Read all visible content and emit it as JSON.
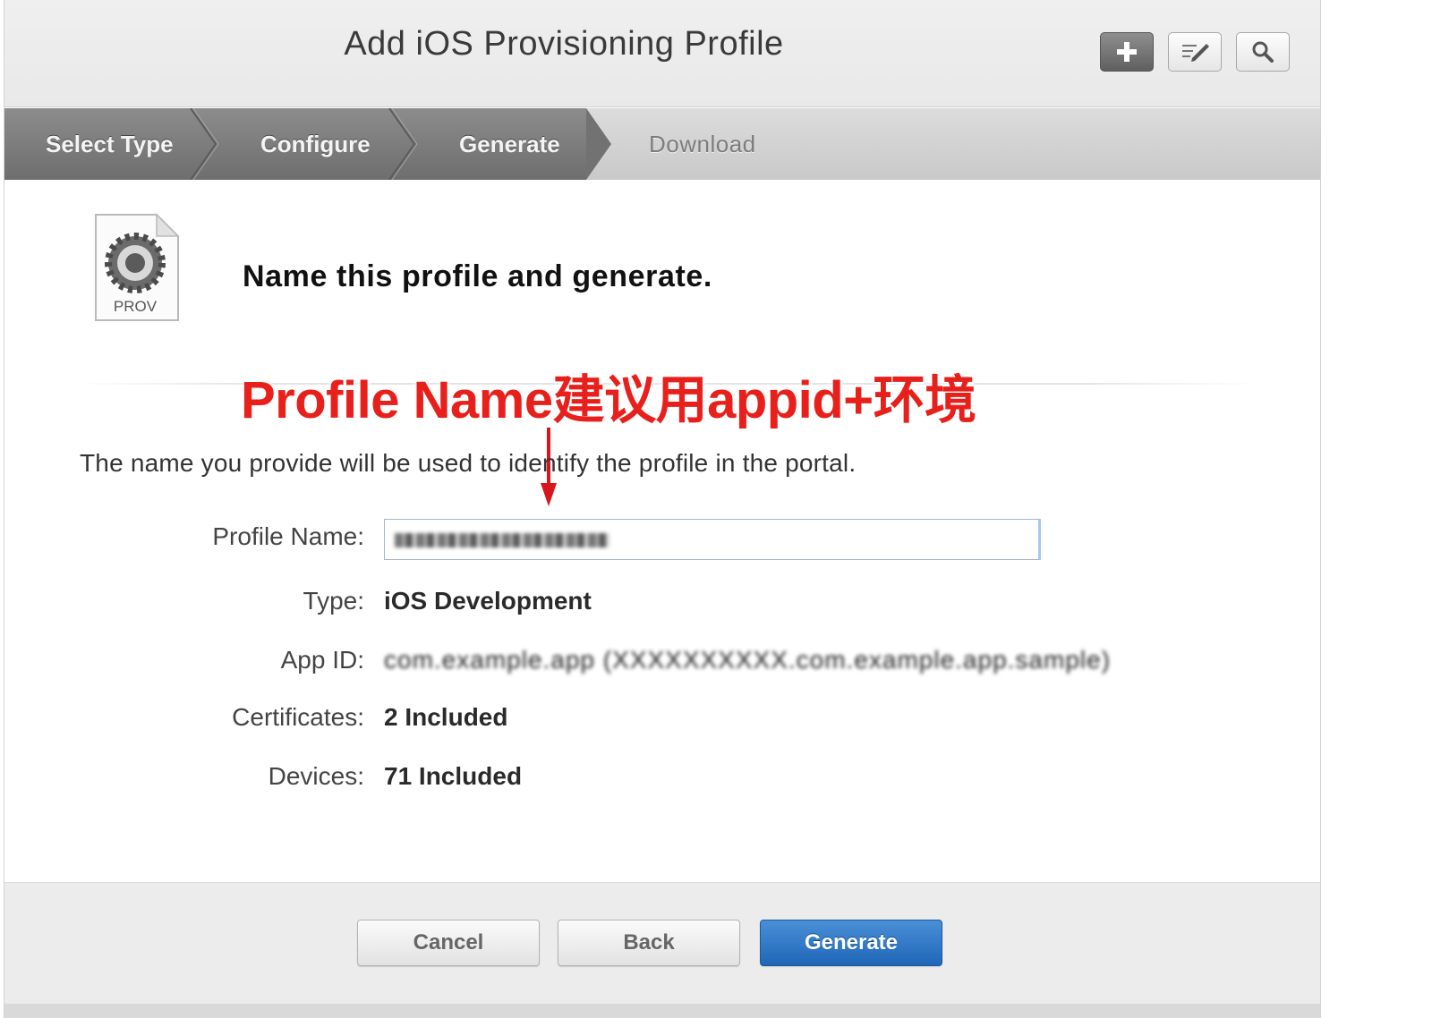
{
  "header": {
    "title": "Add iOS Provisioning Profile",
    "add_icon": "plus-icon",
    "edit_icon": "edit-icon",
    "search_icon": "search-icon"
  },
  "steps": [
    {
      "label": "Select Type",
      "state": "done"
    },
    {
      "label": "Configure",
      "state": "done"
    },
    {
      "label": "Generate",
      "state": "current"
    },
    {
      "label": "Download",
      "state": "pending"
    }
  ],
  "content": {
    "icon_label": "PROV",
    "heading": "Name this profile and generate.",
    "annotation": "Profile Name建议用appid+环境",
    "description": "The name you provide will be used to identify the profile in the portal."
  },
  "form": {
    "profile_name_label": "Profile Name:",
    "type_label": "Type:",
    "type_value": "iOS Development",
    "app_id_label": "App ID:",
    "app_id_value": "com.example.app (XXXXXXXXXX.com.example.app.sample)",
    "certificates_label": "Certificates:",
    "certificates_value": "2 Included",
    "devices_label": "Devices:",
    "devices_value": "71 Included"
  },
  "footer": {
    "cancel_label": "Cancel",
    "back_label": "Back",
    "generate_label": "Generate"
  },
  "colors": {
    "annotation": "#e8201c",
    "primary_button": "#2a72c4",
    "active_steps": "#7a7a7a"
  }
}
